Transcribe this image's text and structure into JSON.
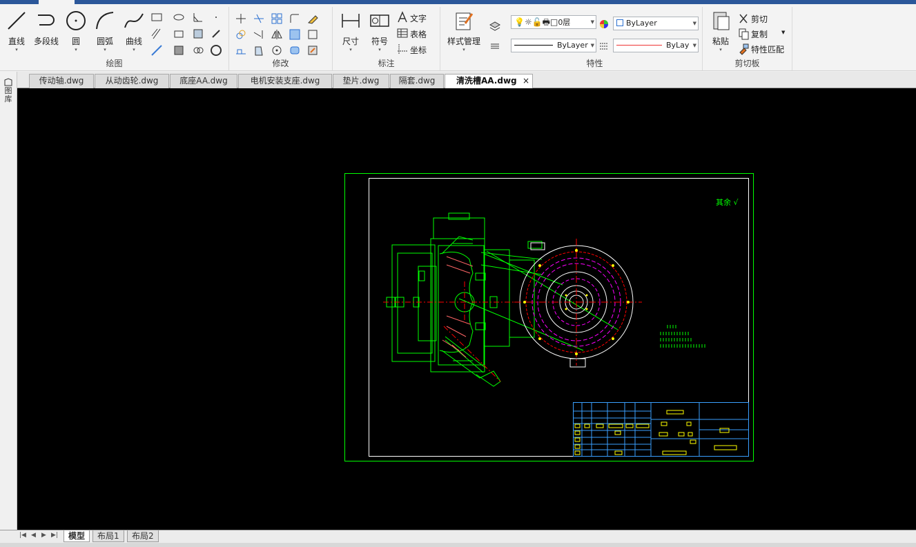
{
  "ribbon": {
    "draw": {
      "title": "绘图",
      "line": "直线",
      "polyline": "多段线",
      "circle": "圆",
      "arc": "圆弧",
      "curve": "曲线"
    },
    "modify": {
      "title": "修改"
    },
    "annotate": {
      "title": "标注",
      "dimension": "尺寸",
      "symbol": "符号",
      "text": "文字",
      "table": "表格",
      "coord": "坐标"
    },
    "style": {
      "manager": "样式管理"
    },
    "properties": {
      "title": "特性",
      "layer": "0层",
      "color": "ByLayer",
      "linetype": "ByLayer",
      "lineweight": "ByLay"
    },
    "clipboard": {
      "title": "剪切板",
      "paste": "粘贴",
      "cut": "剪切",
      "copy": "复制",
      "match": "特性匹配"
    }
  },
  "file_tabs": [
    "传动轴.dwg",
    "从动齿轮.dwg",
    "底座AA.dwg",
    "电机安装支座.dwg",
    "垫片.dwg",
    "隔套.dwg",
    "清洗槽AA.dwg"
  ],
  "active_tab_close": "×",
  "left_strip": "图库",
  "drawing": {
    "roughness_label": "其余 √"
  },
  "layout_tabs": [
    "模型",
    "布局1",
    "布局2"
  ],
  "colors": {
    "canvas_bg": "#000000",
    "frame": "#00ff00",
    "border": "#ffffff",
    "centerline": "#ff0000",
    "hidden": "#ff00ff",
    "table": "#3aa0ff",
    "text": "#ffff00"
  }
}
